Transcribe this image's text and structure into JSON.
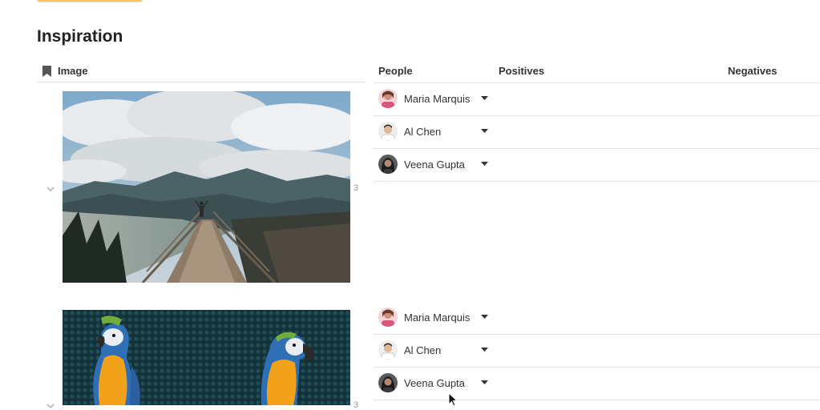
{
  "section": {
    "title": "Inspiration"
  },
  "columns": {
    "image": "Image",
    "people": "People",
    "positives": "Positives",
    "negatives": "Negatives"
  },
  "groups": [
    {
      "count": "3",
      "image_subject": "person standing at the end of a wooden viewing platform above a mountain lake",
      "people": [
        {
          "name": "Maria Marquis",
          "avatar": "pink-shirt-avatar"
        },
        {
          "name": "Al Chen",
          "avatar": "white-shirt-avatar"
        },
        {
          "name": "Veena Gupta",
          "avatar": "dark-hair-avatar"
        }
      ]
    },
    {
      "count": "3",
      "image_subject": "two blue and yellow macaws on a teal patterned background",
      "people": [
        {
          "name": "Maria Marquis",
          "avatar": "pink-shirt-avatar"
        },
        {
          "name": "Al Chen",
          "avatar": "white-shirt-avatar"
        },
        {
          "name": "Veena Gupta",
          "avatar": "dark-hair-avatar"
        }
      ]
    }
  ],
  "colors": {
    "accent_button": "#f5c066",
    "divider": "#e4e4e4",
    "text": "#333333"
  }
}
